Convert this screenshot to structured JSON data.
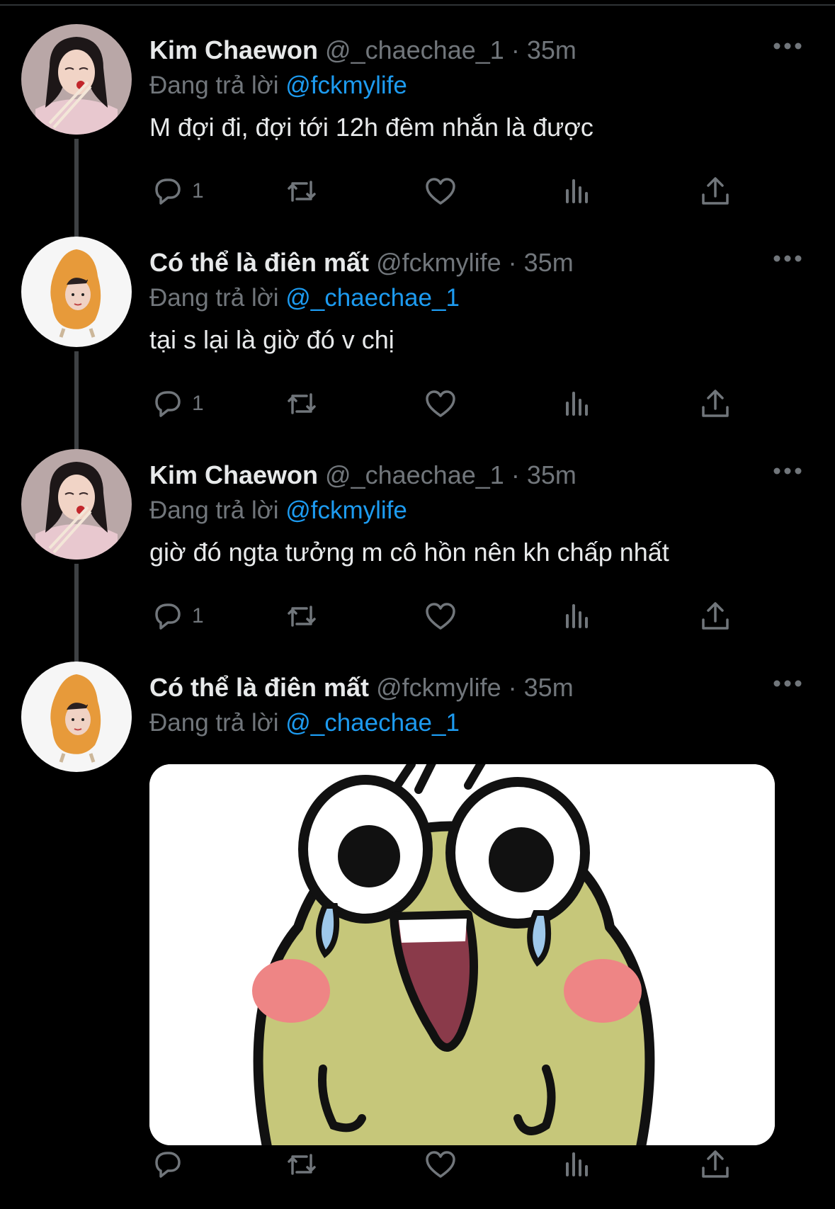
{
  "tweets": [
    {
      "name": "Kim Chaewon",
      "handle": "@_chaechae_1",
      "separator": "·",
      "time": "35m",
      "reply_prefix": "Đang trả lời",
      "reply_to": "@fckmylife",
      "text": "M đợi đi, đợi tới 12h đêm nhắn là được",
      "reply_count": "1"
    },
    {
      "name": "Có thể là điên mất",
      "handle": "@fckmylife",
      "separator": "·",
      "time": "35m",
      "reply_prefix": "Đang trả lời",
      "reply_to": "@_chaechae_1",
      "text": "tại s lại là giờ đó v chị",
      "reply_count": "1"
    },
    {
      "name": "Kim Chaewon",
      "handle": "@_chaechae_1",
      "separator": "·",
      "time": "35m",
      "reply_prefix": "Đang trả lời",
      "reply_to": "@fckmylife",
      "text": "giờ đó ngta tưởng m cô hồn nên kh chấp nhất",
      "reply_count": "1"
    },
    {
      "name": "Có thể là điên mất",
      "handle": "@fckmylife",
      "separator": "·",
      "time": "35m",
      "reply_prefix": "Đang trả lời",
      "reply_to": "@_chaechae_1",
      "media": "crying-laughing-frog-sticker"
    }
  ],
  "icons": {
    "reply": "reply-icon",
    "retweet": "retweet-icon",
    "like": "heart-icon",
    "stats": "stats-icon",
    "share": "share-icon",
    "more": "more-icon"
  },
  "colors": {
    "background": "#000000",
    "text": "#e7e9ea",
    "secondary": "#71767b",
    "link": "#1d9bf0",
    "thread_line": "#3e4144"
  }
}
